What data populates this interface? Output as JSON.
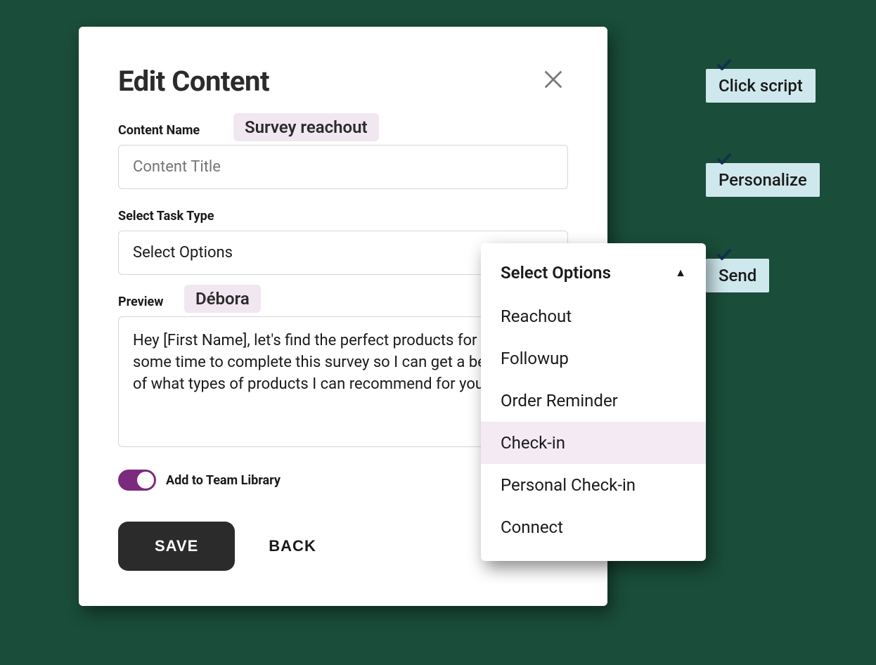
{
  "modal": {
    "title": "Edit Content",
    "content_name_label": "Content Name",
    "content_name_placeholder": "Content Title",
    "content_name_pill": "Survey reachout",
    "task_type_label": "Select Task Type",
    "task_type_placeholder": "Select Options",
    "preview_label": "Preview",
    "preview_pill": "Débora",
    "preview_text": "Hey [First Name], let's find the perfect products for you! Take some time to complete this survey so I can get a better idea of what types of products I can recommend for you!",
    "toggle_label": "Add to Team Library",
    "toggle_on": true,
    "save_label": "SAVE",
    "back_label": "BACK"
  },
  "dropdown": {
    "header": "Select Options",
    "options": [
      "Reachout",
      "Followup",
      "Order Reminder",
      "Check-in",
      "Personal Check-in",
      "Connect"
    ],
    "highlighted": "Check-in"
  },
  "steps": [
    {
      "label": "Click script"
    },
    {
      "label": "Personalize"
    },
    {
      "label": "Send"
    }
  ]
}
